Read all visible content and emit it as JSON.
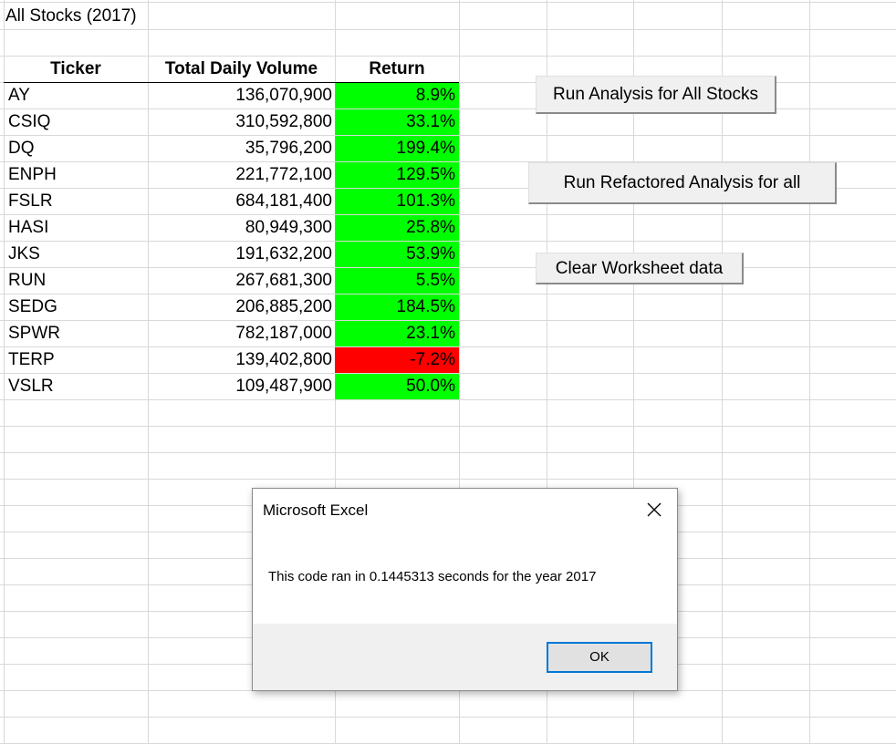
{
  "sheet": {
    "title": "All Stocks (2017)",
    "headers": {
      "ticker": "Ticker",
      "volume": "Total Daily Volume",
      "return": "Return"
    },
    "rows": [
      {
        "ticker": "AY",
        "volume": "136,070,900",
        "ret": "8.9%",
        "status": "positive"
      },
      {
        "ticker": "CSIQ",
        "volume": "310,592,800",
        "ret": "33.1%",
        "status": "positive"
      },
      {
        "ticker": "DQ",
        "volume": "35,796,200",
        "ret": "199.4%",
        "status": "positive"
      },
      {
        "ticker": "ENPH",
        "volume": "221,772,100",
        "ret": "129.5%",
        "status": "positive"
      },
      {
        "ticker": "FSLR",
        "volume": "684,181,400",
        "ret": "101.3%",
        "status": "positive"
      },
      {
        "ticker": "HASI",
        "volume": "80,949,300",
        "ret": "25.8%",
        "status": "positive"
      },
      {
        "ticker": "JKS",
        "volume": "191,632,200",
        "ret": "53.9%",
        "status": "positive"
      },
      {
        "ticker": "RUN",
        "volume": "267,681,300",
        "ret": "5.5%",
        "status": "positive"
      },
      {
        "ticker": "SEDG",
        "volume": "206,885,200",
        "ret": "184.5%",
        "status": "positive"
      },
      {
        "ticker": "SPWR",
        "volume": "782,187,000",
        "ret": "23.1%",
        "status": "positive"
      },
      {
        "ticker": "TERP",
        "volume": "139,402,800",
        "ret": "-7.2%",
        "status": "negative"
      },
      {
        "ticker": "VSLR",
        "volume": "109,487,900",
        "ret": "50.0%",
        "status": "positive"
      }
    ]
  },
  "buttons": {
    "run_all": "Run Analysis for All Stocks",
    "run_refactored": "Run Refactored Analysis for all",
    "clear": "Clear Worksheet data"
  },
  "dialog": {
    "title": "Microsoft Excel",
    "message": "This code ran in 0.1445313 seconds for the year 2017",
    "ok": "OK",
    "close_icon": "close-icon"
  },
  "colors": {
    "positive": "#00ff00",
    "negative": "#ff0000",
    "gridline": "#d9d9d9",
    "ok_border": "#0078d7"
  }
}
